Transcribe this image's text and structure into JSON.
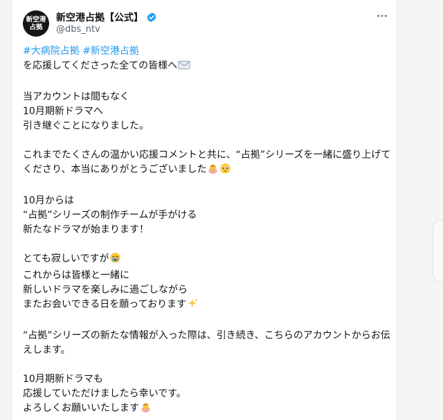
{
  "account": {
    "avatar_line1": "新空港",
    "avatar_line2": "占拠",
    "display_name": "新空港占拠【公式】",
    "handle": "@dbs_ntv",
    "verified_icon": "verified-badge-icon",
    "more_icon": "more-options-icon"
  },
  "colors": {
    "hashtag": "#1d9bf0",
    "text": "#0f1419",
    "muted": "#536471",
    "verified": "#1d9bf0"
  },
  "tweet": {
    "hashtag1": "#大病院占拠",
    "hashtag2": "#新空港占拠",
    "p1_l2": "を応援してくださった全ての皆様へ",
    "p2_l1": "当アカウントは間もなく",
    "p2_l2": "10月期新ドラマへ",
    "p2_l3": "引き継ぐことになりました。",
    "p3_l1": "これまでたくさんの温かい応援コメントと共に、“占拠”シリーズを一緒に盛り上げてくださり、本当にありがとうございました",
    "p4_l1": "10月からは",
    "p4_l2": "“占拠”シリーズの制作チームが手がける",
    "p4_l3": "新たなドラマが始まります！",
    "p5_l1": "とても寂しいですが",
    "p5_l2": "これからは皆様と一緒に",
    "p5_l3": "新しいドラマを楽しみに過ごしながら",
    "p5_l4": "またお会いできる日を願っております",
    "p6_l1": "“占拠”シリーズの新たな情報が入った際は、引き続き、こちらのアカウントからお伝えします。",
    "p7_l1": "10月期新ドラマも",
    "p7_l2": "応援していただけましたら幸いです。",
    "p7_l3": "よろしくお願いいたします"
  },
  "emojis": {
    "envelope": "envelope-icon",
    "bowing_woman": "bowing-woman-icon",
    "pleading_face": "pleading-face-icon",
    "crying_face": "loudly-crying-face-icon",
    "sparkles": "sparkles-icon"
  }
}
